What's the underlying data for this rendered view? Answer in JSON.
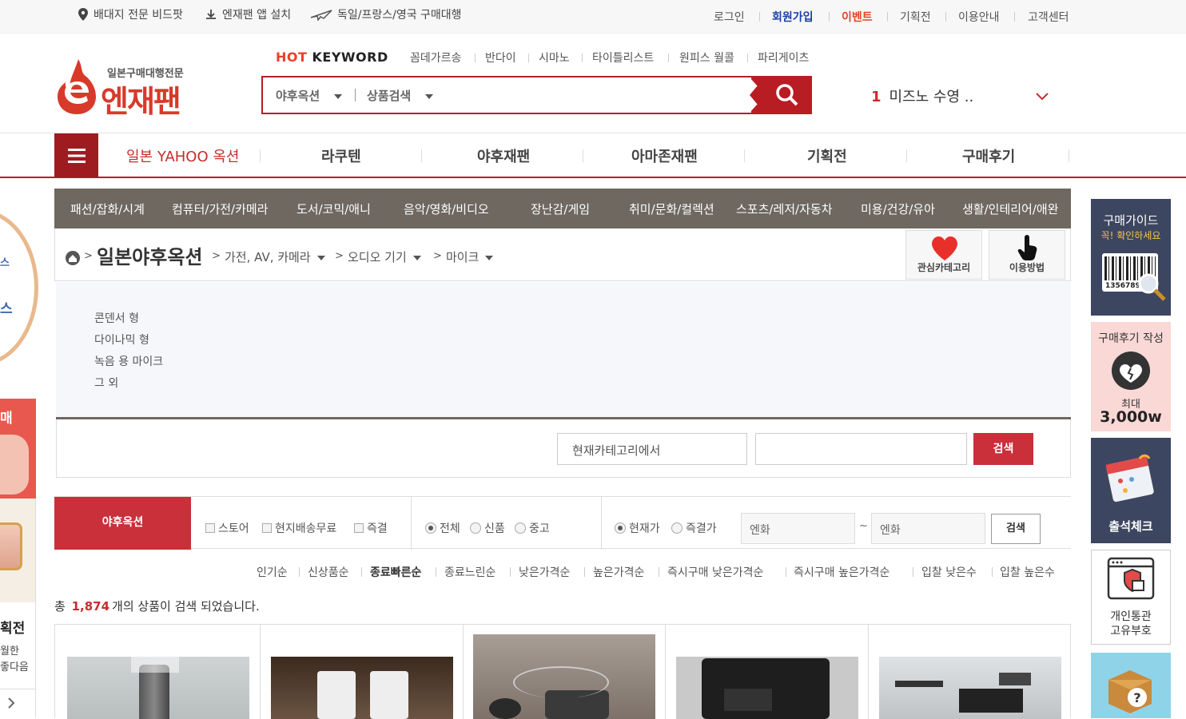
{
  "topbar": {
    "left": [
      {
        "icon": "map-pin-icon",
        "label": "배대지 전문 비드팟"
      },
      {
        "icon": "download-icon",
        "label": "엔재팬 앱 설치"
      },
      {
        "icon": "airplane-icon",
        "label": "독일/프랑스/영국 구매대행"
      }
    ],
    "right": [
      "로그인",
      "회원가입",
      "이벤트",
      "기획전",
      "이용안내",
      "고객센터"
    ],
    "colors": {
      "signup": "#1a3fa8",
      "event": "#e8402a"
    }
  },
  "logo": {
    "tagline": "일본구매대행전문",
    "name": "엔재팬"
  },
  "hot_keyword": {
    "label_hot": "HOT",
    "label_keyword": "KEYWORD",
    "items": [
      "꼼데가르송",
      "반다이",
      "시마노",
      "타이틀리스트",
      "원피스 월콜",
      "파리게이츠"
    ]
  },
  "search": {
    "site_select": "야후옥션",
    "type_select": "상품검색",
    "value": "",
    "button_icon": "search-icon"
  },
  "rank": {
    "number": "1",
    "text": "미즈노 수영 .."
  },
  "main_nav": [
    "일본 YAHOO 옥션",
    "라쿠텐",
    "야후재팬",
    "아마존재팬",
    "기획전",
    "구매후기"
  ],
  "categories": [
    "패션/잡화/시계",
    "컴퓨터/가전/카메라",
    "도서/코믹/애니",
    "음악/영화/비디오",
    "장난감/게임",
    "취미/문화/컬렉션",
    "스포츠/레저/자동차",
    "미용/건강/유아",
    "생활/인테리어/애완"
  ],
  "breadcrumb": {
    "title": "일본야후옥션",
    "items": [
      "가전, AV, 카메라",
      "오디오 기기",
      "마이크"
    ]
  },
  "tools": [
    {
      "icon": "heart-icon",
      "label": "관심카테고리"
    },
    {
      "icon": "hand-pointer-icon",
      "label": "이용방법"
    }
  ],
  "subcategories": [
    "콘덴서 형",
    "다이나믹 형",
    "녹음 용 마이크",
    "그 외"
  ],
  "category_search": {
    "scope": "현재카테고리에서",
    "value": "",
    "button": "검색"
  },
  "filter": {
    "tab": "야후옥션",
    "checkboxes": [
      "스토어",
      "현지배송무료",
      "즉결"
    ],
    "condition": {
      "options": [
        "전체",
        "신품",
        "중고"
      ],
      "selected": "전체"
    },
    "price_type": {
      "options": [
        "현재가",
        "즉결가"
      ],
      "selected": "현재가"
    },
    "price_min_placeholder": "엔화",
    "tilde": "~",
    "price_max_placeholder": "엔화",
    "button": "검색"
  },
  "sort": [
    "인기순",
    "신상품순",
    "종료빠른순",
    "종료느린순",
    "낮은가격순",
    "높은가격순",
    "즉시구매 낮은가격순",
    "즉시구매 높은가격순",
    "입찰 낮은수",
    "입찰 높은수"
  ],
  "result": {
    "prefix": "총",
    "count": "1,874",
    "suffix": "개의 상품이 검색 되었습니다."
  },
  "right_banners": [
    {
      "title": "구매가이드",
      "sub": "꼭! 확인하세요",
      "code": "1356789"
    },
    {
      "title": "구매후기 작성",
      "sub": "최대",
      "amount": "3,000w"
    },
    {
      "title": "출석체크"
    },
    {
      "title": "개인통관",
      "sub": "고유부호"
    }
  ],
  "left_banners": {
    "badge_text": [
      "스",
      "스"
    ],
    "label": "매",
    "event_title": "획전",
    "event_line1": "월한",
    "event_line2": "좋다음"
  }
}
